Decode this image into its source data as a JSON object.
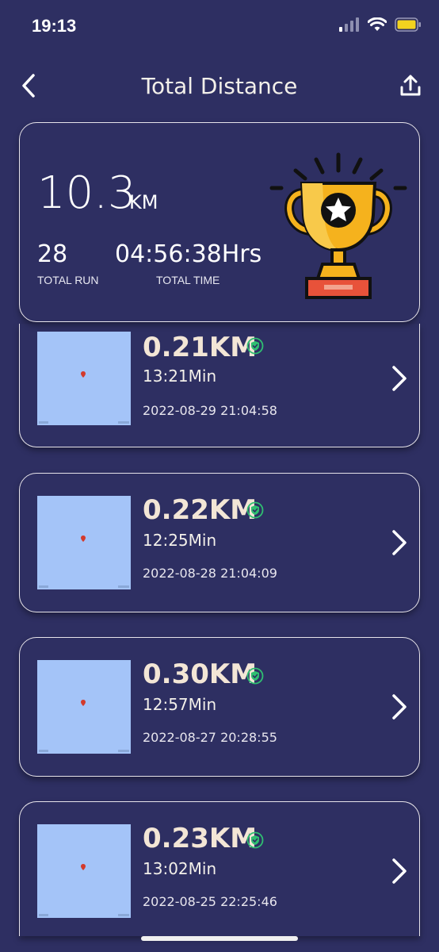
{
  "status": {
    "time": "19:13"
  },
  "header": {
    "title": "Total Distance"
  },
  "summary": {
    "distance": "10.3",
    "distance_unit": "KM",
    "total_runs": "28",
    "total_runs_label": "TOTAL RUN",
    "total_time": "04:56:38Hrs",
    "total_time_label": "TOTAL TIME"
  },
  "runs": [
    {
      "distance": "0.21KM",
      "duration": "13:21Min",
      "datetime": "2022-08-29 21:04:58"
    },
    {
      "distance": "0.22KM",
      "duration": "12:25Min",
      "datetime": "2022-08-28 21:04:09"
    },
    {
      "distance": "0.30KM",
      "duration": "12:57Min",
      "datetime": "2022-08-27 20:28:55"
    },
    {
      "distance": "0.23KM",
      "duration": "13:02Min",
      "datetime": "2022-08-25 22:25:46"
    }
  ],
  "colors": {
    "background": "#2e2f62",
    "card_border": "#e6e3ea",
    "map": "#a4c4f8",
    "verified": "#2fbf71",
    "trophy": "#f5b21d"
  },
  "icons": [
    "back-arrow-icon",
    "share-icon",
    "trophy-icon",
    "verified-shield-icon",
    "chevron-right-icon",
    "wifi-icon",
    "signal-icon",
    "battery-icon"
  ]
}
